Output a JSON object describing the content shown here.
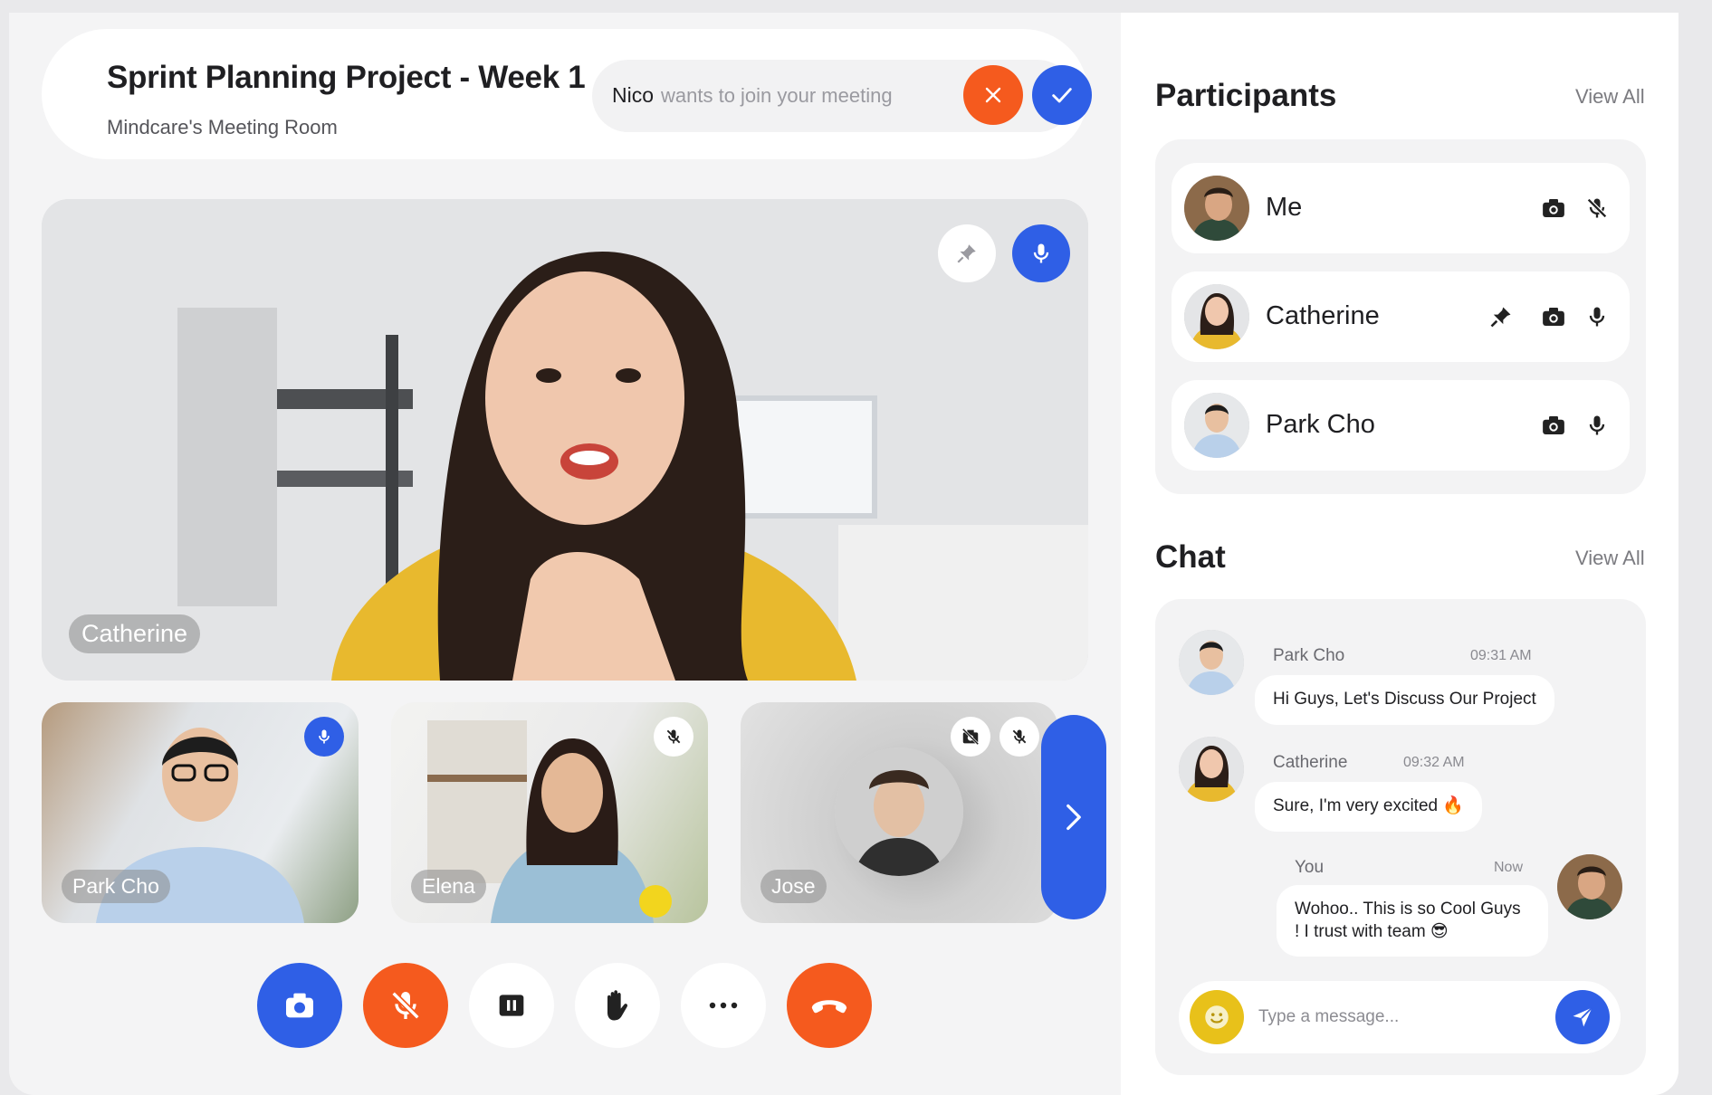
{
  "header": {
    "title": "Sprint Planning Project - Week 1",
    "subtitle": "Mindcare's Meeting Room",
    "join_request": {
      "name": "Nico",
      "message": "wants to join your meeting"
    }
  },
  "main_video": {
    "name": "Catherine"
  },
  "thumbnails": [
    {
      "name": "Park Cho",
      "mic": "on"
    },
    {
      "name": "Elena",
      "mic": "off"
    },
    {
      "name": "Jose",
      "mic": "off",
      "camera": "off"
    }
  ],
  "controls": [
    "camera-icon",
    "mic-off-icon",
    "pause-icon",
    "raise-hand-icon",
    "more-icon",
    "end-call-icon"
  ],
  "participants": {
    "title": "Participants",
    "view_all": "View All",
    "items": [
      {
        "name": "Me",
        "pinned": false,
        "camera": "on",
        "mic": "off"
      },
      {
        "name": "Catherine",
        "pinned": true,
        "camera": "on",
        "mic": "on"
      },
      {
        "name": "Park Cho",
        "pinned": false,
        "camera": "on",
        "mic": "on"
      }
    ]
  },
  "chat": {
    "title": "Chat",
    "view_all": "View All",
    "messages": [
      {
        "sender": "Park Cho",
        "time": "09:31 AM",
        "text": "Hi Guys, Let's Discuss Our Project"
      },
      {
        "sender": "Catherine",
        "time": "09:32 AM",
        "text": "Sure, I'm very excited 🔥"
      },
      {
        "sender": "You",
        "time": "Now",
        "text": "Wohoo.. This is so Cool Guys ! I trust with team 😎"
      }
    ],
    "input_placeholder": "Type a message..."
  },
  "colors": {
    "accent_blue": "#2f5fe6",
    "accent_orange": "#f55a1e",
    "background": "#f4f4f5"
  }
}
